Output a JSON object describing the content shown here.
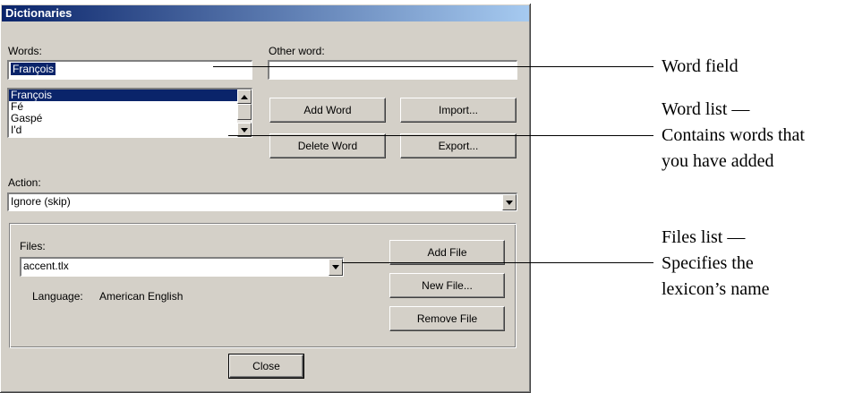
{
  "dialog": {
    "title": "Dictionaries",
    "words_label": "Words:",
    "word_value": "François",
    "other_word_label": "Other word:",
    "other_word_value": "",
    "word_list": [
      "François",
      "Fé",
      "Gaspé",
      "I'd"
    ],
    "buttons": {
      "add_word": "Add Word",
      "import": "Import...",
      "delete_word": "Delete Word",
      "export": "Export...",
      "add_file": "Add File",
      "new_file": "New File...",
      "remove_file": "Remove File",
      "close": "Close"
    },
    "action_label": "Action:",
    "action_value": "Ignore (skip)",
    "files_label": "Files:",
    "files_value": "accent.tlx",
    "language_label": "Language:",
    "language_value": "American English"
  },
  "annotations": {
    "word_field": "Word field",
    "word_list_line1": "Word list —",
    "word_list_line2": "Contains words that",
    "word_list_line3": "you have added",
    "files_list_line1": "Files list —",
    "files_list_line2": "Specifies the",
    "files_list_line3": "lexicon’s name"
  },
  "icons": [
    "arrow-up-icon",
    "arrow-down-icon",
    "dropdown-arrow-icon"
  ]
}
